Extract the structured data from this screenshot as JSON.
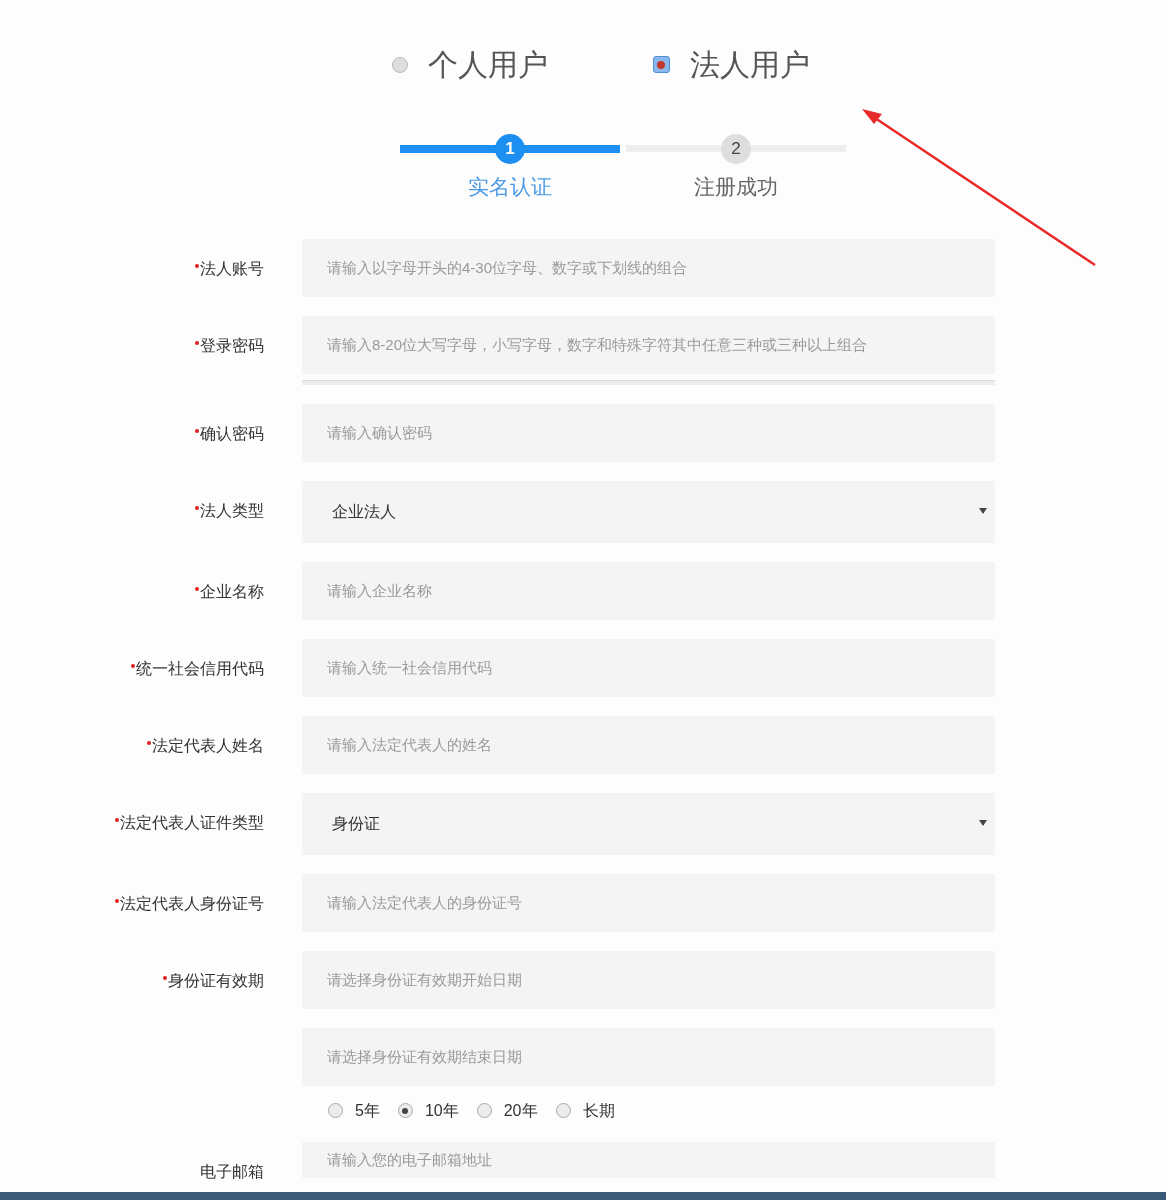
{
  "user_types": [
    {
      "label": "个人用户",
      "selected": false
    },
    {
      "label": "法人用户",
      "selected": true
    }
  ],
  "steps": [
    {
      "number": "1",
      "label": "实名认证",
      "selected": true
    },
    {
      "number": "2",
      "label": "注册成功",
      "selected": false
    }
  ],
  "fields": [
    {
      "kind": "input",
      "label": "法人账号",
      "required": true,
      "placeholder": "请输入以字母开头的4-30位字母、数字或下划线的组合"
    },
    {
      "kind": "input",
      "label": "登录密码",
      "required": true,
      "placeholder": "请输入8-20位大写字母，小写字母，数字和特殊字符其中任意三种或三种以上组合",
      "strength_bar": true
    },
    {
      "kind": "input",
      "label": "确认密码",
      "required": true,
      "placeholder": "请输入确认密码"
    },
    {
      "kind": "select",
      "label": "法人类型",
      "required": true,
      "value": "企业法人"
    },
    {
      "kind": "input",
      "label": "企业名称",
      "required": true,
      "placeholder": "请输入企业名称"
    },
    {
      "kind": "input",
      "label": "统一社会信用代码",
      "required": true,
      "placeholder": "请输入统一社会信用代码"
    },
    {
      "kind": "input",
      "label": "法定代表人姓名",
      "required": true,
      "placeholder": "请输入法定代表人的姓名"
    },
    {
      "kind": "select",
      "label": "法定代表人证件类型",
      "required": true,
      "value": "身份证"
    },
    {
      "kind": "input",
      "label": "法定代表人身份证号",
      "required": true,
      "placeholder": "请输入法定代表人的身份证号"
    },
    {
      "kind": "input",
      "label": "身份证有效期",
      "required": true,
      "placeholder": "请选择身份证有效期开始日期"
    },
    {
      "kind": "input",
      "placeholder": "请选择身份证有效期结束日期"
    },
    {
      "kind": "radios",
      "options": [
        {
          "label": "5年",
          "selected": false
        },
        {
          "label": "10年",
          "selected": true
        },
        {
          "label": "20年",
          "selected": false
        },
        {
          "label": "长期",
          "selected": false
        }
      ]
    },
    {
      "kind": "input",
      "label": "电子邮箱",
      "required": false,
      "placeholder": "请输入您的电子邮箱地址"
    }
  ]
}
